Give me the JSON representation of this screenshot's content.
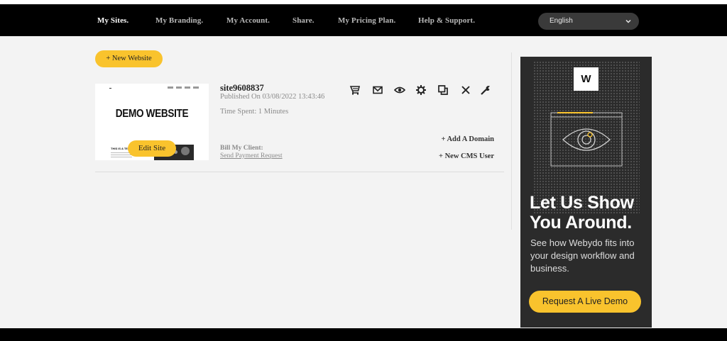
{
  "nav": {
    "items": [
      {
        "label": "My Sites.",
        "active": true
      },
      {
        "label": "My Branding.",
        "active": false
      },
      {
        "label": "My Account.",
        "active": false
      },
      {
        "label": "Share.",
        "active": false
      },
      {
        "label": "My Pricing Plan.",
        "active": false
      },
      {
        "label": "Help & Support.",
        "active": false
      }
    ],
    "language": {
      "selected": "English",
      "icon": "chevron-down-icon"
    }
  },
  "main": {
    "new_website_label": "+ New Website",
    "site": {
      "name": "site9608837",
      "published": "Published On 03/08/2022 13:43:46",
      "time_spent": "Time Spent: 1 Minutes",
      "bill_label": "Bill My Client:",
      "send_payment": "Send Payment Request",
      "edit_label": "Edit Site",
      "add_domain": "+ Add A Domain",
      "new_cms_user": "+ New CMS User",
      "thumbnail": {
        "title": "DEMO WEBSITE",
        "subhead": "THIS IS A TEX"
      },
      "actions": [
        {
          "icon": "cart-icon"
        },
        {
          "icon": "mail-icon"
        },
        {
          "icon": "eye-icon"
        },
        {
          "icon": "gear-icon"
        },
        {
          "icon": "duplicate-icon"
        },
        {
          "icon": "close-icon"
        },
        {
          "icon": "wrench-icon"
        }
      ]
    }
  },
  "ad": {
    "logo": "W",
    "headline": "Let Us Show You Around.",
    "subtext": "See how Webydo fits into your design workflow and business.",
    "cta": "Request A Live Demo"
  },
  "colors": {
    "accent": "#f9c32d",
    "nav_bg": "#000000",
    "ad_bg": "#2b2b2b",
    "page_bg": "#f3f3f3"
  }
}
